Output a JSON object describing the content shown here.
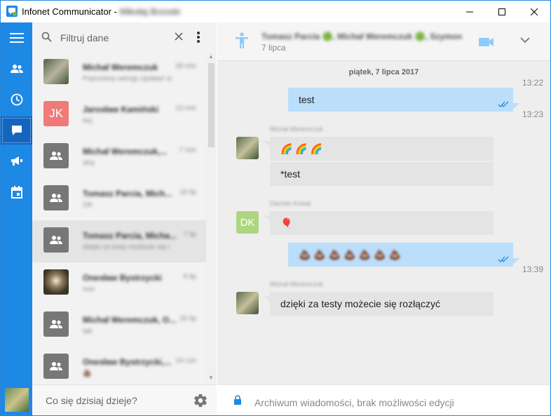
{
  "window": {
    "title": "Infonet Communicator - ",
    "user": "Mikołaj Brzoski"
  },
  "colors": {
    "rail": "#1e88e5",
    "outgoing_bubble": "#bbdefb",
    "incoming_bubble": "#e4e4e4",
    "jk_avatar": "#ef7a78",
    "dk_avatar": "#aed581"
  },
  "search": {
    "placeholder": "Filtruj dane"
  },
  "conversations": [
    {
      "name": "Michał Weremczuk",
      "time": "28 min",
      "preview": "Poprosimy wersję Update/ w",
      "avatar": "photo"
    },
    {
      "name": "Jarosław Kamiński",
      "time": "13 min",
      "preview": "hej",
      "avatar": "JK"
    },
    {
      "name": "Michał Weremczuk,...",
      "time": "7 min",
      "preview": "aha",
      "avatar": "group"
    },
    {
      "name": "Tomasz Parcia, Mich...",
      "time": "19 lip",
      "preview": "OK",
      "avatar": "group"
    },
    {
      "name": "Tomasz Parcia, Micha...",
      "time": "7 lip",
      "preview": "dzięki za testy możecie się r",
      "avatar": "group"
    },
    {
      "name": "Onesław Bystrzycki",
      "time": "9 lip",
      "preview": "ooo",
      "avatar": "cat"
    },
    {
      "name": "Michał Weremczuk, O...",
      "time": "16 lip",
      "preview": "tak",
      "avatar": "group"
    },
    {
      "name": "Onesław Bystrzycki,...",
      "time": "24 cze",
      "preview": "💩",
      "avatar": "group"
    }
  ],
  "status": {
    "placeholder": "Co się dzisiaj dzieje?"
  },
  "chat": {
    "participants": "Tomasz Parcia 🟢, Michał Weremczuk 🟢, Szymon",
    "date": "7 lipca",
    "day_separator": "piątek, 7 lipca 2017",
    "messages": [
      {
        "id": "m1",
        "dir": "out",
        "text": "test",
        "time_before": "13:22",
        "time_after": "13:23"
      },
      {
        "id": "m2",
        "dir": "in",
        "sender": "Michał Weremczuk",
        "text": "🌈 🌈 🌈"
      },
      {
        "id": "m3",
        "dir": "in",
        "text": "*test"
      },
      {
        "id": "m4",
        "dir": "in",
        "sender": "Damian Kowal",
        "avatar": "DK",
        "text": "🎈"
      },
      {
        "id": "m5",
        "dir": "out",
        "text": "💩💩💩💩💩💩💩",
        "time_after": "13:39"
      },
      {
        "id": "m6",
        "dir": "in",
        "sender": "Michał Weremczuk",
        "text": "dzięki za testy możecie się rozłączyć"
      }
    ],
    "footer": "Archiwum wiadomości, brak możliwości edycji"
  },
  "icons": {
    "rail": [
      "menu-icon",
      "contacts-icon",
      "history-icon",
      "chat-icon",
      "megaphone-icon",
      "calendar-icon"
    ],
    "header": [
      "person-icon",
      "video-icon",
      "chevron-down-icon"
    ],
    "footer": [
      "lock-icon"
    ],
    "list": [
      "search-icon",
      "close-icon",
      "more-vert-icon",
      "settings-icon"
    ]
  }
}
